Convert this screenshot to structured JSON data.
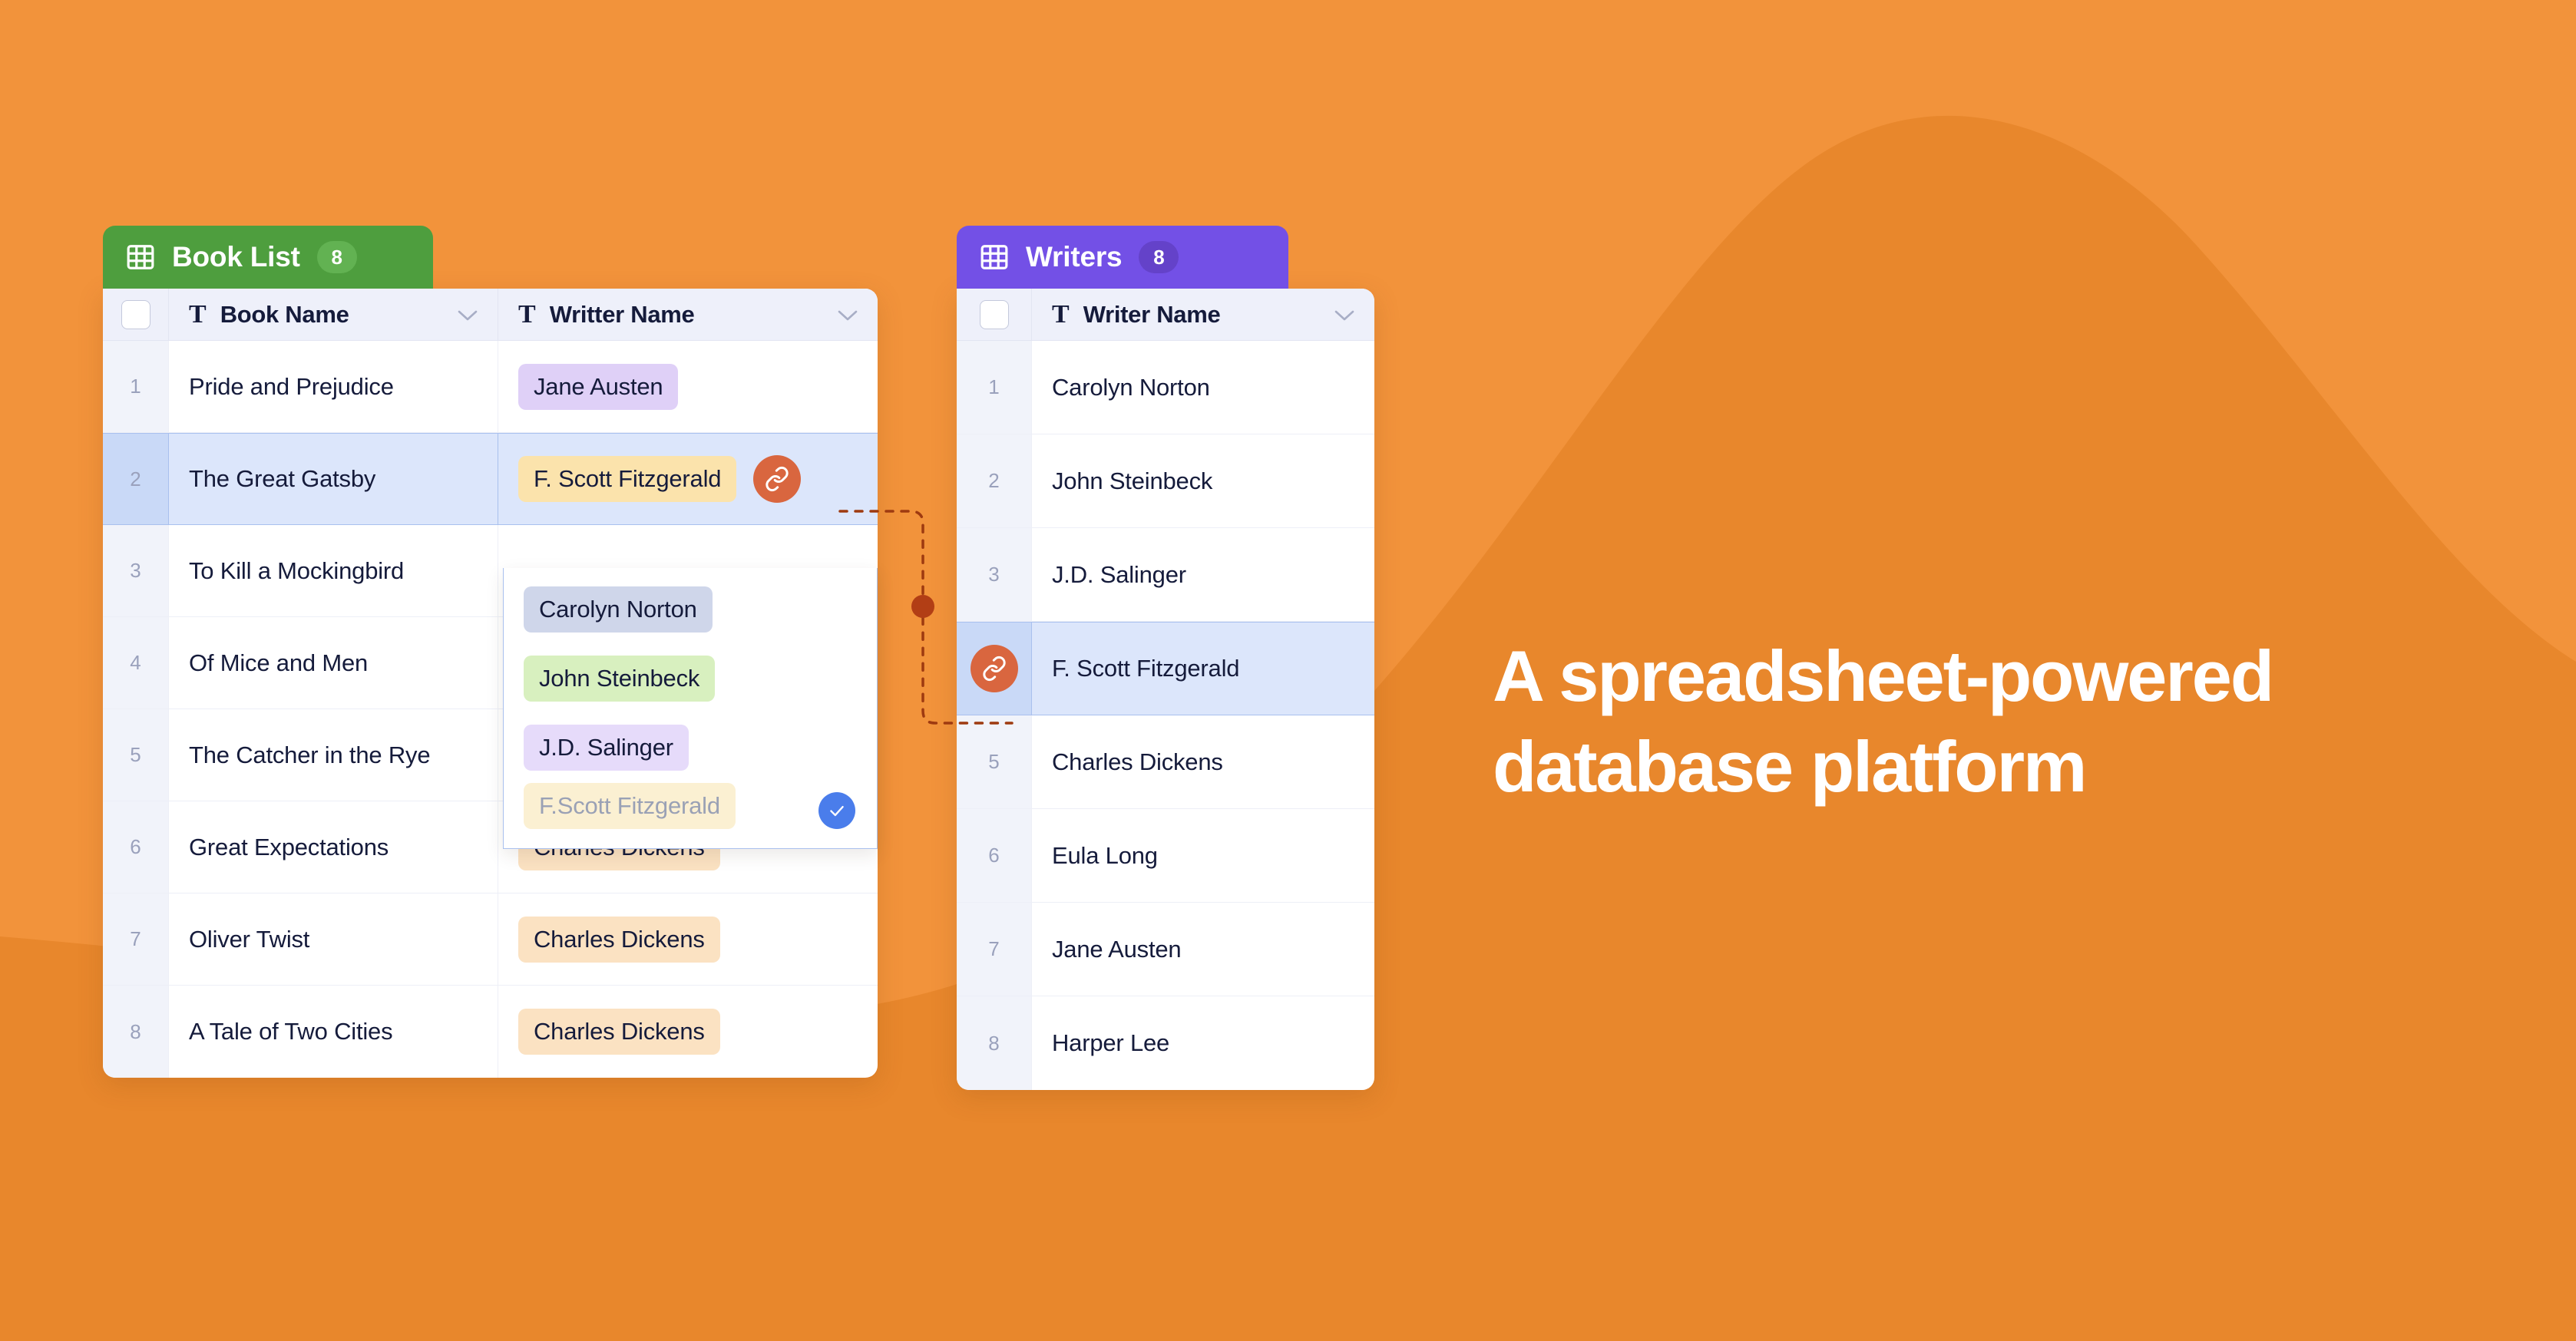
{
  "background": {
    "base_color": "#F2933B",
    "swoosh_color": "#E8872C"
  },
  "tagline": {
    "line1": "A spreadsheet-powered",
    "line2": "database platform",
    "color": "#FFFFFF"
  },
  "book_list": {
    "tab": {
      "title": "Book List",
      "count": "8",
      "icon": "grid-icon",
      "color": "#4E9E3E"
    },
    "columns": [
      {
        "label": "Book Name",
        "type_icon": "text-type-icon",
        "menu_icon": "chevron-down-icon"
      },
      {
        "label": "Writter Name",
        "type_icon": "text-type-icon",
        "menu_icon": "chevron-down-icon"
      }
    ],
    "rows": [
      {
        "index": "1",
        "book": "Pride and Prejudice",
        "writer": "Jane Austen",
        "tag_color": "#DFD0F7",
        "selected": false
      },
      {
        "index": "2",
        "book": "The Great Gatsby",
        "writer": "F. Scott Fitzgerald",
        "tag_color": "#FBE3AC",
        "selected": true
      },
      {
        "index": "3",
        "book": "To Kill a Mockingbird",
        "writer": "",
        "tag_color": "",
        "selected": false
      },
      {
        "index": "4",
        "book": "Of Mice and Men",
        "writer": "",
        "tag_color": "",
        "selected": false
      },
      {
        "index": "5",
        "book": "The Catcher in the Rye",
        "writer": "",
        "tag_color": "",
        "selected": false
      },
      {
        "index": "6",
        "book": "Great Expectations",
        "writer": "Charles Dickens",
        "tag_color": "#FBE2C2",
        "selected": false
      },
      {
        "index": "7",
        "book": "Oliver Twist",
        "writer": "Charles Dickens",
        "tag_color": "#FBE2C2",
        "selected": false
      },
      {
        "index": "8",
        "book": "A Tale of Two Cities",
        "writer": "Charles Dickens",
        "tag_color": "#FBE2C2",
        "selected": false
      }
    ]
  },
  "dropdown": {
    "options": [
      {
        "label": "Carolyn Norton",
        "tag_color": "#CFD6EA",
        "text_color": "#151B3B",
        "checked": false
      },
      {
        "label": "John Steinbeck",
        "tag_color": "#D8F0BF",
        "text_color": "#151B3B",
        "checked": false
      },
      {
        "label": "J.D. Salinger",
        "tag_color": "#E6DBFA",
        "text_color": "#151B3B",
        "checked": false
      },
      {
        "label": "F.Scott Fitzgerald",
        "tag_color": "#FBF0D2",
        "text_color": "#9AA1B5",
        "checked": true
      }
    ],
    "check_icon": "check-icon",
    "check_color": "#4A7DEB"
  },
  "writers": {
    "tab": {
      "title": "Writers",
      "count": "8",
      "icon": "grid-icon",
      "color": "#7350E6"
    },
    "columns": [
      {
        "label": "Writer Name",
        "type_icon": "text-type-icon",
        "menu_icon": "chevron-down-icon"
      }
    ],
    "rows": [
      {
        "index": "1",
        "name": "Carolyn Norton",
        "selected": false
      },
      {
        "index": "2",
        "name": "John Steinbeck",
        "selected": false
      },
      {
        "index": "3",
        "name": "J.D. Salinger",
        "selected": false
      },
      {
        "index": "4",
        "name": "F. Scott Fitzgerald",
        "selected": true
      },
      {
        "index": "5",
        "name": "Charles Dickens",
        "selected": false
      },
      {
        "index": "6",
        "name": "Eula Long",
        "selected": false
      },
      {
        "index": "7",
        "name": "Jane Austen",
        "selected": false
      },
      {
        "index": "8",
        "name": "Harper Lee",
        "selected": false
      }
    ]
  },
  "connector": {
    "icon": "link-icon",
    "color": "#D9663F",
    "line_style": "dashed",
    "dot_color": "#B23E15"
  }
}
